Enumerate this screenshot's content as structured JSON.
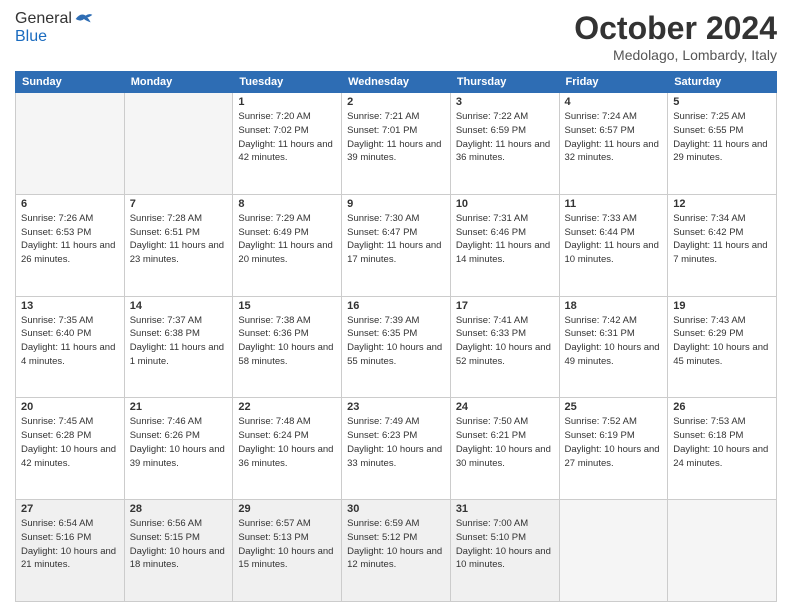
{
  "header": {
    "logo_general": "General",
    "logo_blue": "Blue",
    "month_title": "October 2024",
    "location": "Medolago, Lombardy, Italy"
  },
  "days_of_week": [
    "Sunday",
    "Monday",
    "Tuesday",
    "Wednesday",
    "Thursday",
    "Friday",
    "Saturday"
  ],
  "weeks": [
    [
      {
        "day": "",
        "empty": true
      },
      {
        "day": "",
        "empty": true
      },
      {
        "day": "1",
        "sunrise": "7:20 AM",
        "sunset": "7:02 PM",
        "daylight": "11 hours and 42 minutes."
      },
      {
        "day": "2",
        "sunrise": "7:21 AM",
        "sunset": "7:01 PM",
        "daylight": "11 hours and 39 minutes."
      },
      {
        "day": "3",
        "sunrise": "7:22 AM",
        "sunset": "6:59 PM",
        "daylight": "11 hours and 36 minutes."
      },
      {
        "day": "4",
        "sunrise": "7:24 AM",
        "sunset": "6:57 PM",
        "daylight": "11 hours and 32 minutes."
      },
      {
        "day": "5",
        "sunrise": "7:25 AM",
        "sunset": "6:55 PM",
        "daylight": "11 hours and 29 minutes."
      }
    ],
    [
      {
        "day": "6",
        "sunrise": "7:26 AM",
        "sunset": "6:53 PM",
        "daylight": "11 hours and 26 minutes."
      },
      {
        "day": "7",
        "sunrise": "7:28 AM",
        "sunset": "6:51 PM",
        "daylight": "11 hours and 23 minutes."
      },
      {
        "day": "8",
        "sunrise": "7:29 AM",
        "sunset": "6:49 PM",
        "daylight": "11 hours and 20 minutes."
      },
      {
        "day": "9",
        "sunrise": "7:30 AM",
        "sunset": "6:47 PM",
        "daylight": "11 hours and 17 minutes."
      },
      {
        "day": "10",
        "sunrise": "7:31 AM",
        "sunset": "6:46 PM",
        "daylight": "11 hours and 14 minutes."
      },
      {
        "day": "11",
        "sunrise": "7:33 AM",
        "sunset": "6:44 PM",
        "daylight": "11 hours and 10 minutes."
      },
      {
        "day": "12",
        "sunrise": "7:34 AM",
        "sunset": "6:42 PM",
        "daylight": "11 hours and 7 minutes."
      }
    ],
    [
      {
        "day": "13",
        "sunrise": "7:35 AM",
        "sunset": "6:40 PM",
        "daylight": "11 hours and 4 minutes."
      },
      {
        "day": "14",
        "sunrise": "7:37 AM",
        "sunset": "6:38 PM",
        "daylight": "11 hours and 1 minute."
      },
      {
        "day": "15",
        "sunrise": "7:38 AM",
        "sunset": "6:36 PM",
        "daylight": "10 hours and 58 minutes."
      },
      {
        "day": "16",
        "sunrise": "7:39 AM",
        "sunset": "6:35 PM",
        "daylight": "10 hours and 55 minutes."
      },
      {
        "day": "17",
        "sunrise": "7:41 AM",
        "sunset": "6:33 PM",
        "daylight": "10 hours and 52 minutes."
      },
      {
        "day": "18",
        "sunrise": "7:42 AM",
        "sunset": "6:31 PM",
        "daylight": "10 hours and 49 minutes."
      },
      {
        "day": "19",
        "sunrise": "7:43 AM",
        "sunset": "6:29 PM",
        "daylight": "10 hours and 45 minutes."
      }
    ],
    [
      {
        "day": "20",
        "sunrise": "7:45 AM",
        "sunset": "6:28 PM",
        "daylight": "10 hours and 42 minutes."
      },
      {
        "day": "21",
        "sunrise": "7:46 AM",
        "sunset": "6:26 PM",
        "daylight": "10 hours and 39 minutes."
      },
      {
        "day": "22",
        "sunrise": "7:48 AM",
        "sunset": "6:24 PM",
        "daylight": "10 hours and 36 minutes."
      },
      {
        "day": "23",
        "sunrise": "7:49 AM",
        "sunset": "6:23 PM",
        "daylight": "10 hours and 33 minutes."
      },
      {
        "day": "24",
        "sunrise": "7:50 AM",
        "sunset": "6:21 PM",
        "daylight": "10 hours and 30 minutes."
      },
      {
        "day": "25",
        "sunrise": "7:52 AM",
        "sunset": "6:19 PM",
        "daylight": "10 hours and 27 minutes."
      },
      {
        "day": "26",
        "sunrise": "7:53 AM",
        "sunset": "6:18 PM",
        "daylight": "10 hours and 24 minutes."
      }
    ],
    [
      {
        "day": "27",
        "sunrise": "6:54 AM",
        "sunset": "5:16 PM",
        "daylight": "10 hours and 21 minutes."
      },
      {
        "day": "28",
        "sunrise": "6:56 AM",
        "sunset": "5:15 PM",
        "daylight": "10 hours and 18 minutes."
      },
      {
        "day": "29",
        "sunrise": "6:57 AM",
        "sunset": "5:13 PM",
        "daylight": "10 hours and 15 minutes."
      },
      {
        "day": "30",
        "sunrise": "6:59 AM",
        "sunset": "5:12 PM",
        "daylight": "10 hours and 12 minutes."
      },
      {
        "day": "31",
        "sunrise": "7:00 AM",
        "sunset": "5:10 PM",
        "daylight": "10 hours and 10 minutes."
      },
      {
        "day": "",
        "empty": true
      },
      {
        "day": "",
        "empty": true
      }
    ]
  ]
}
